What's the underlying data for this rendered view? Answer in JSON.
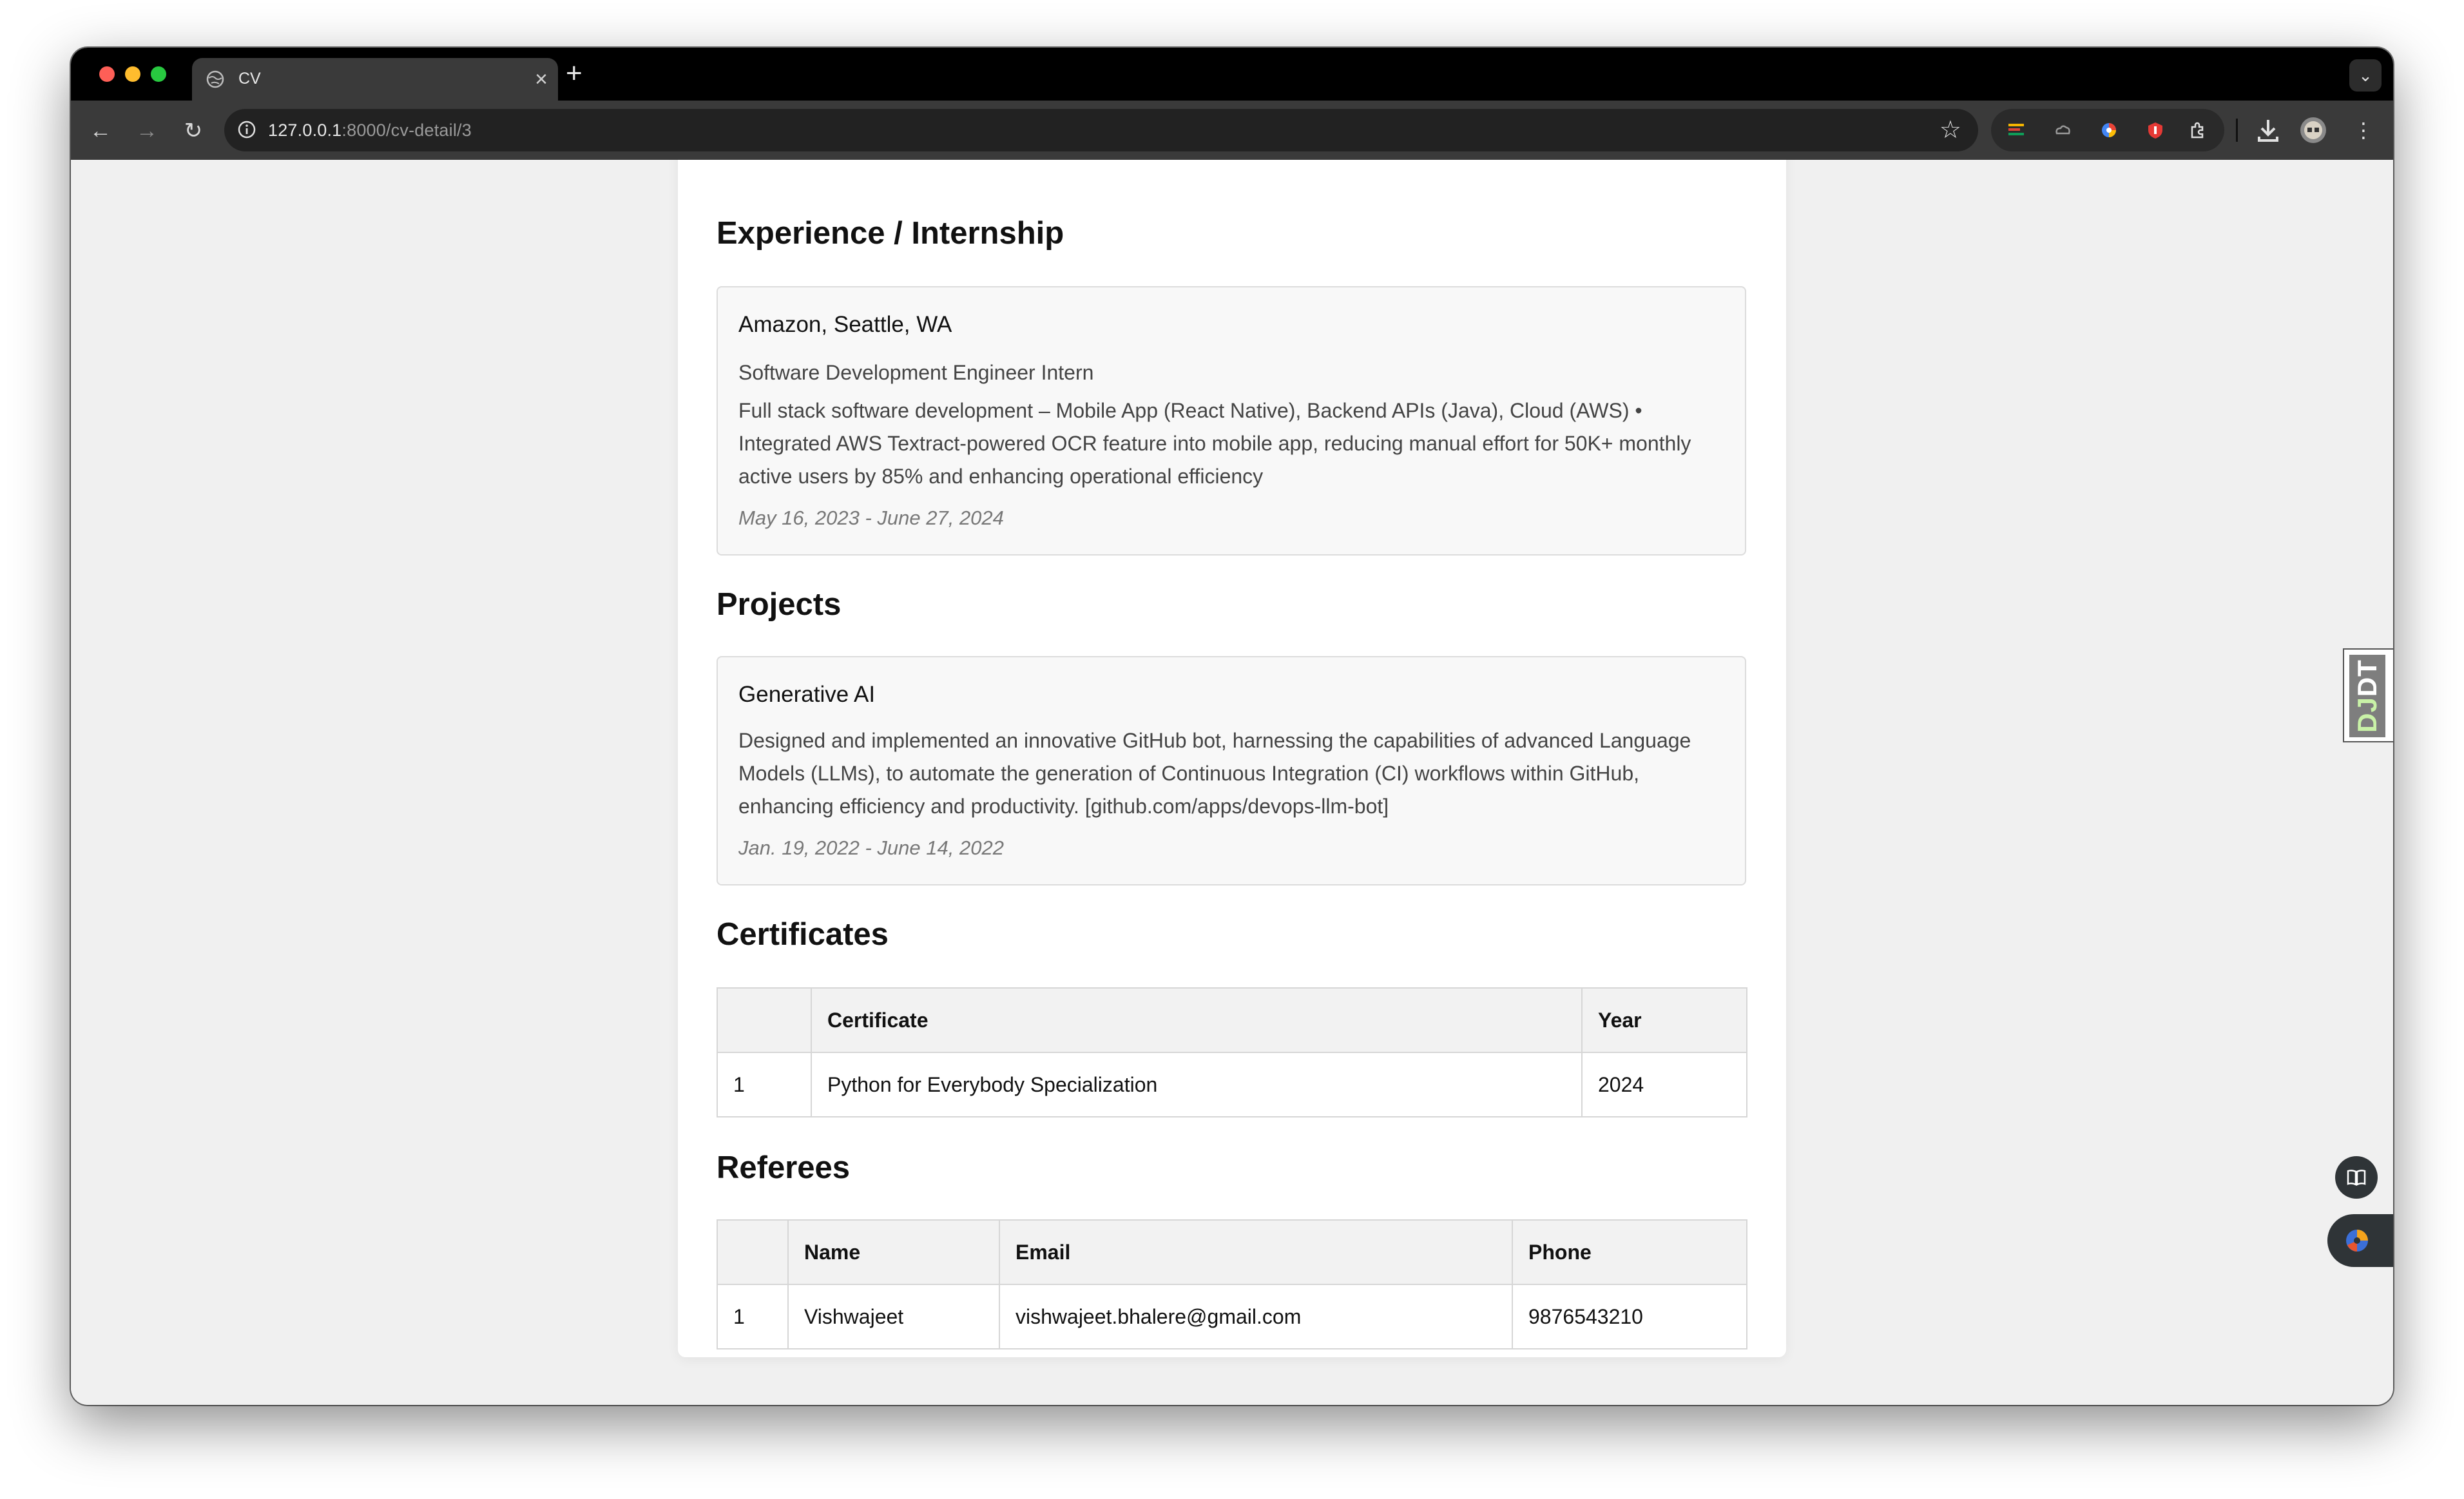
{
  "browser": {
    "tab_title": "CV",
    "url_host": "127.0.0.1",
    "url_rest": ":8000/cv-detail/3"
  },
  "experience": {
    "heading": "Experience / Internship",
    "items": [
      {
        "company": "Amazon, Seattle, WA",
        "role": "Software Development Engineer Intern",
        "description": "Full stack software development – Mobile App (React Native), Backend APIs (Java), Cloud (AWS) • Integrated AWS Textract-powered OCR feature into mobile app, reducing manual effort for 50K+ monthly active users by 85% and enhancing operational efficiency",
        "dates": "May 16, 2023 - June 27, 2024"
      }
    ]
  },
  "projects": {
    "heading": "Projects",
    "items": [
      {
        "title": "Generative AI",
        "description": "Designed and implemented an innovative GitHub bot, harnessing the capabilities of advanced Language Models (LLMs), to automate the generation of Continuous Integration (CI) workflows within GitHub, enhancing efficiency and productivity. [github.com/apps/devops-llm-bot]",
        "dates": "Jan. 19, 2022 - June 14, 2022"
      }
    ]
  },
  "certificates": {
    "heading": "Certificates",
    "columns": [
      "",
      "Certificate",
      "Year"
    ],
    "rows": [
      [
        "1",
        "Python for Everybody Specialization",
        "2024"
      ]
    ]
  },
  "referees": {
    "heading": "Referees",
    "columns": [
      "",
      "Name",
      "Email",
      "Phone"
    ],
    "rows": [
      [
        "1",
        "Vishwajeet",
        "vishwajeet.bhalere@gmail.com",
        "9876543210"
      ]
    ]
  },
  "widgets": {
    "debug_toolbar_label_a": "DJ",
    "debug_toolbar_label_b": "DT"
  },
  "colors": {
    "page_bg": "#f0f0f0",
    "card_bg": "#ffffff",
    "box_bg": "#f8f8f8",
    "table_header_bg": "#f2f2f2",
    "browser_chrome": "#3a3a3a"
  }
}
